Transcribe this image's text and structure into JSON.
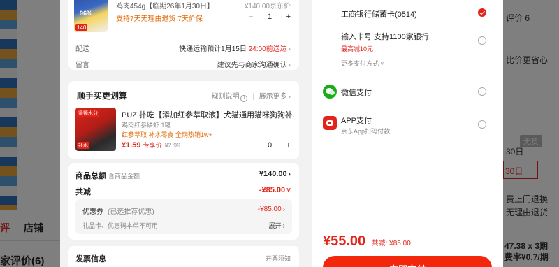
{
  "background": {
    "tabs": {
      "reviews_active": "评",
      "shop": "店铺"
    },
    "reviews_heading": "家评价(6)",
    "right_texts": {
      "rating": "评价 6",
      "more": "比价更省心",
      "none_badge": "无货",
      "day30a": "30日",
      "day30b": "30日",
      "pickup": "费上门退换",
      "return": "无理由退货",
      "installment": "47.38 x 3期",
      "perday": "费率¥0.7/期"
    }
  },
  "order": {
    "product": {
      "spec": "鸡肉454g【临期26年1月30日】",
      "price": "¥140.00",
      "price_note": "京东价",
      "service": "支持7天无理由退货   7天价保",
      "qty": "1",
      "thumb_percent": "96%",
      "thumb_tag": "140"
    },
    "delivery": {
      "label": "配送",
      "value": "快递运输预计1月15日",
      "highlight": "24:00前送达"
    },
    "message": {
      "label": "留言",
      "value": "建议先与商家沟通确认"
    },
    "addon": {
      "title": "顺手买更划算",
      "rules": "规则说明",
      "more": "展示更多",
      "name": "PUZI扑吃【添加红参萃取液】犬猫通用猫咪狗狗补...",
      "spec": "鸡肉红参磷虾 1罐",
      "promo": "红参萃取 补水零食 全网热销1w+",
      "price": "¥1.59",
      "price_tag": "专享价",
      "orig_price": "¥2.99",
      "qty": "0",
      "img_label": "紧锁水分",
      "img_label2": "补水"
    },
    "totals": {
      "goods_label": "商品总额",
      "goods_sub": "含商品金额",
      "goods_value": "¥140.00",
      "discount_label": "共减",
      "discount_value": "-¥85.00",
      "coupon_label": "优惠券",
      "coupon_sub": "(已选推荐优惠)",
      "coupon_value": "-¥85.00",
      "coupon_note": "礼品卡、优惠码本单不可用",
      "expand": "展开"
    },
    "invoice": {
      "title": "发票信息",
      "link": "开票须知"
    }
  },
  "payment": {
    "options": [
      {
        "name": "工商银行储蓄卡(0514)",
        "checked": true
      },
      {
        "name": "输入卡号 支持1100家银行",
        "sub": "最高减10元",
        "checked": false
      },
      {
        "name": "微信支付",
        "checked": false
      },
      {
        "name": "APP支付",
        "sub": "京东App扫码付款",
        "checked": false
      }
    ],
    "more": "更多支付方式",
    "final_amount": "¥55.00",
    "final_discount": "共减: ¥85.00",
    "pay_button": "立即支付"
  },
  "colors": {
    "accent": "#e1251b",
    "wechat": "#1aad19"
  }
}
